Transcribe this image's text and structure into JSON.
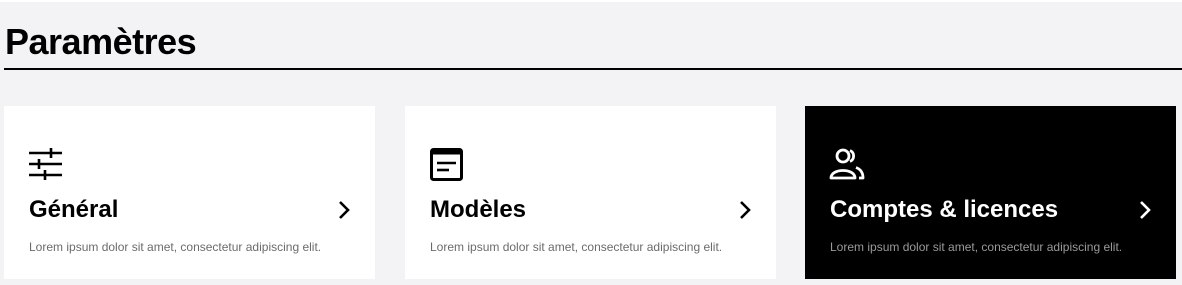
{
  "page": {
    "title": "Paramètres"
  },
  "cards": [
    {
      "title": "Général",
      "description": "Lorem ipsum dolor sit amet, consectetur adipiscing elit.",
      "icon": "sliders-icon",
      "selected": false
    },
    {
      "title": "Modèles",
      "description": "Lorem ipsum dolor sit amet, consectetur adipiscing elit.",
      "icon": "template-icon",
      "selected": false
    },
    {
      "title": "Comptes & licences",
      "description": "Lorem ipsum dolor sit amet, consectetur adipiscing elit.",
      "icon": "users-icon",
      "selected": true
    }
  ],
  "colors": {
    "background": "#f3f3f5",
    "card": "#ffffff",
    "selected_card": "#000000",
    "text": "#000000",
    "muted": "#6b6b6b"
  }
}
